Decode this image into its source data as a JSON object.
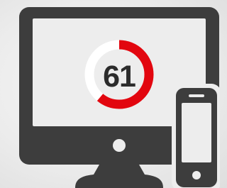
{
  "score": {
    "value": "61",
    "percent": 61
  },
  "icons": {
    "monitor": "desktop-monitor-icon",
    "phone": "smartphone-icon"
  },
  "colors": {
    "device": "#3d3d3d",
    "screen": "#ededed",
    "gauge_fill": "#e2060f",
    "gauge_track": "#ffffff",
    "score_text": "#2b2b2b"
  }
}
